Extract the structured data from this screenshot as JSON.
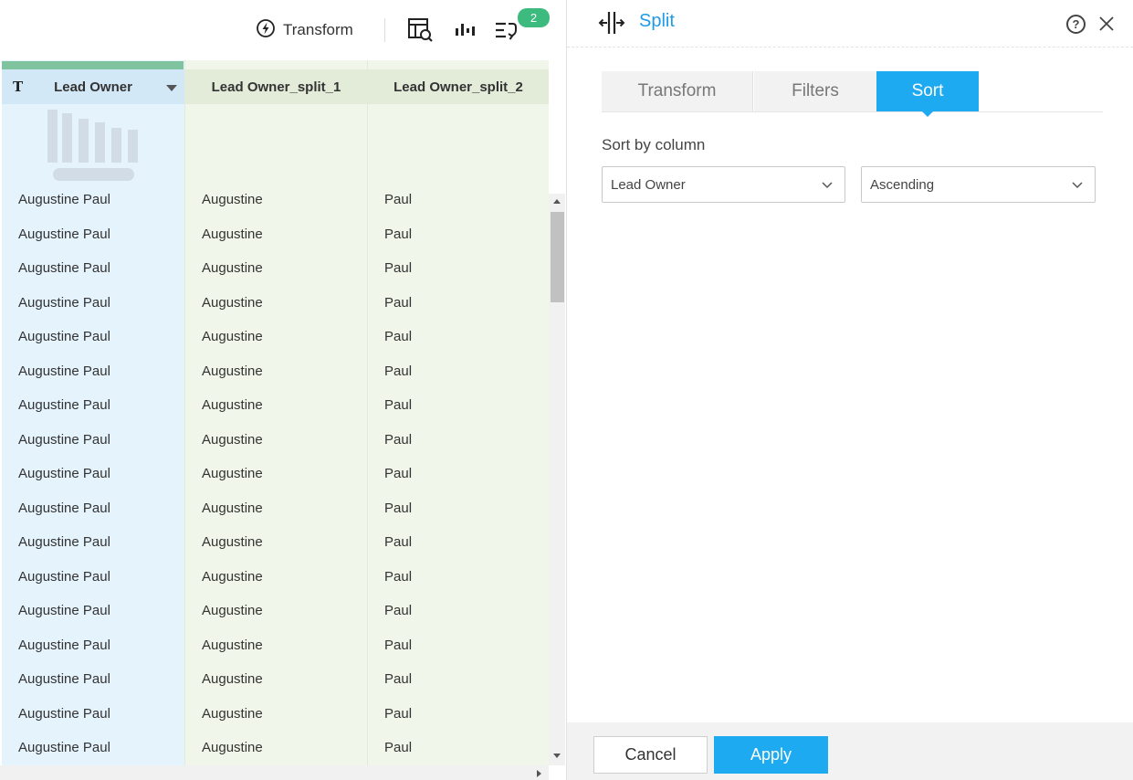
{
  "toolbar": {
    "transform_label": "Transform",
    "transform_icon": "lightning-bolt-icon",
    "view_data_icon": "table-search-icon",
    "stats_icon": "profile-bars-icon",
    "steps_icon": "applied-steps-icon",
    "steps_badge": "2"
  },
  "grid": {
    "columns": [
      {
        "header": "Lead Owner",
        "type_icon": "T",
        "selected": true
      },
      {
        "header": "Lead Owner_split_1"
      },
      {
        "header": "Lead Owner_split_2"
      }
    ],
    "rows": [
      [
        "Augustine Paul",
        "Augustine",
        "Paul"
      ],
      [
        "Augustine Paul",
        "Augustine",
        "Paul"
      ],
      [
        "Augustine Paul",
        "Augustine",
        "Paul"
      ],
      [
        "Augustine Paul",
        "Augustine",
        "Paul"
      ],
      [
        "Augustine Paul",
        "Augustine",
        "Paul"
      ],
      [
        "Augustine Paul",
        "Augustine",
        "Paul"
      ],
      [
        "Augustine Paul",
        "Augustine",
        "Paul"
      ],
      [
        "Augustine Paul",
        "Augustine",
        "Paul"
      ],
      [
        "Augustine Paul",
        "Augustine",
        "Paul"
      ],
      [
        "Augustine Paul",
        "Augustine",
        "Paul"
      ],
      [
        "Augustine Paul",
        "Augustine",
        "Paul"
      ],
      [
        "Augustine Paul",
        "Augustine",
        "Paul"
      ],
      [
        "Augustine Paul",
        "Augustine",
        "Paul"
      ],
      [
        "Augustine Paul",
        "Augustine",
        "Paul"
      ],
      [
        "Augustine Paul",
        "Augustine",
        "Paul"
      ],
      [
        "Augustine Paul",
        "Augustine",
        "Paul"
      ],
      [
        "Augustine Paul",
        "Augustine",
        "Paul"
      ]
    ]
  },
  "panel": {
    "title": "Split",
    "title_icon": "split-column-icon",
    "help_symbol": "?",
    "tabs": [
      {
        "label": "Transform",
        "active": false
      },
      {
        "label": "Filters",
        "active": false
      },
      {
        "label": "Sort",
        "active": true
      }
    ],
    "sort_by_label": "Sort by column",
    "sort_column_value": "Lead Owner",
    "sort_order_value": "Ascending",
    "cancel_label": "Cancel",
    "apply_label": "Apply"
  },
  "colors": {
    "accent": "#1eaaf1",
    "title_blue": "#1e9be5",
    "badge_green": "#3dba7e",
    "selected_column_bg": "#e5f3fd",
    "split_column_bg": "#f0f6e9"
  }
}
